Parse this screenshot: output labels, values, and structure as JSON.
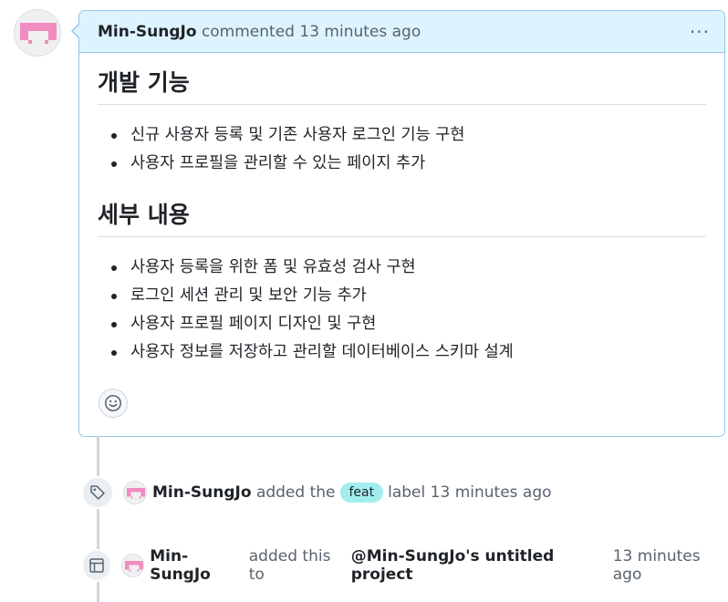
{
  "comment": {
    "author": "Min-SungJo",
    "action": "commented",
    "time": "13 minutes ago",
    "menu_glyph": "···",
    "sections": [
      {
        "heading": "개발 기능",
        "items": [
          "신규 사용자 등록 및 기존 사용자 로그인 기능 구현",
          "사용자 프로필을 관리할 수 있는 페이지 추가"
        ]
      },
      {
        "heading": "세부 내용",
        "items": [
          "사용자 등록을 위한 폼 및 유효성 검사 구현",
          "로그인 세션 관리 및 보안 기능 추가",
          "사용자 프로필 페이지 디자인 및 구현",
          "사용자 정보를 저장하고 관리할 데이터베이스 스키마 설계"
        ]
      }
    ]
  },
  "events": [
    {
      "icon": "tag-icon",
      "actor": "Min-SungJo",
      "text_before": "added the",
      "label": "feat",
      "text_after": "label",
      "time": "13 minutes ago",
      "label_color": "#a2eeef"
    },
    {
      "icon": "table-icon",
      "actor": "Min-SungJo",
      "text_before": "added this to",
      "project": "@Min-SungJo's untitled project",
      "time": "13 minutes ago"
    }
  ],
  "colors": {
    "header_bg": "#ddf4ff",
    "header_border": "#8fc8ee",
    "avatar_accent": "#f08cc0"
  }
}
